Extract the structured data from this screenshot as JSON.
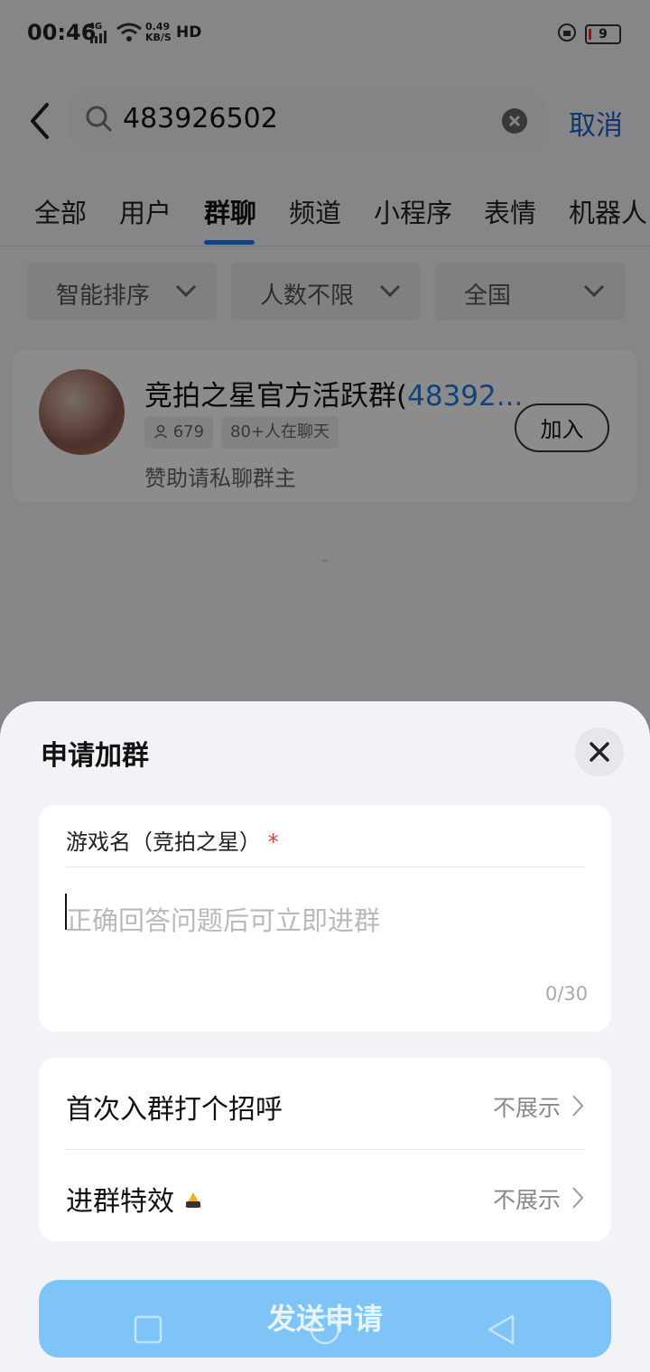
{
  "status_bar": {
    "time": "00:46",
    "network": "4G",
    "speed_value": "0.49",
    "speed_unit": "KB/S",
    "hd": "HD",
    "battery": "9"
  },
  "search": {
    "query": "483926502",
    "cancel_label": "取消"
  },
  "tabs": [
    {
      "label": "全部",
      "active": false
    },
    {
      "label": "用户",
      "active": false
    },
    {
      "label": "群聊",
      "active": true
    },
    {
      "label": "频道",
      "active": false
    },
    {
      "label": "小程序",
      "active": false
    },
    {
      "label": "表情",
      "active": false
    },
    {
      "label": "机器人",
      "active": false
    }
  ],
  "filters": [
    {
      "label": "智能排序"
    },
    {
      "label": "人数不限"
    },
    {
      "label": "全国"
    }
  ],
  "result": {
    "title_prefix": "竞拍之星官方活跃群(",
    "title_number": "48392...",
    "member_count": "679",
    "active_chip": "80+人在聊天",
    "description": "赞助请私聊群主",
    "join_label": "加入"
  },
  "sheet": {
    "title": "申请加群",
    "question_label": "游戏名（竞拍之星）",
    "required_mark": "*",
    "answer_placeholder": "正确回答问题后可立即进群",
    "char_counter": "0/30",
    "options": [
      {
        "label": "首次入群打个招呼",
        "value": "不展示"
      },
      {
        "label": "进群特效",
        "value": "不展示"
      }
    ],
    "send_label": "发送申请"
  },
  "colors": {
    "accent_blue": "#1f79e6",
    "cancel_blue": "#1f61c9",
    "send_button": "#7ec4f7",
    "required_red": "#e04436"
  }
}
